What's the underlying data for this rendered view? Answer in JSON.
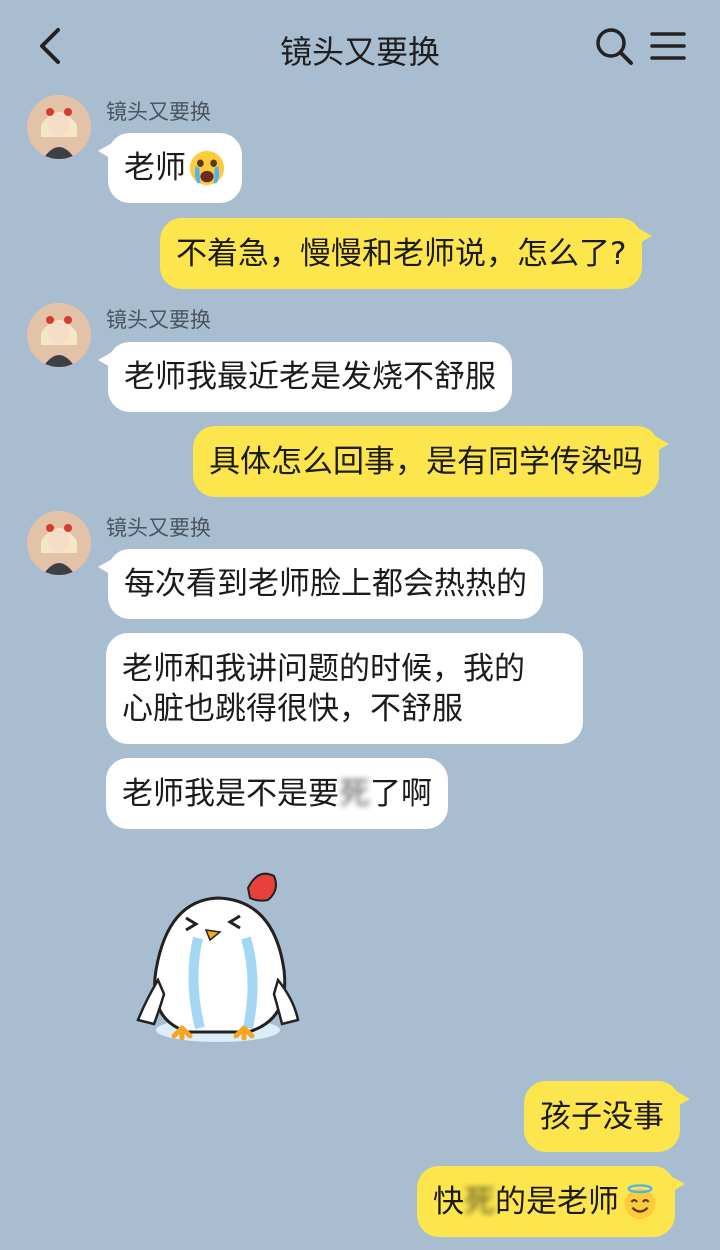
{
  "header": {
    "title": "镜头又要换",
    "back_icon": "chevron-left-icon",
    "search_icon": "search-icon",
    "menu_icon": "hamburger-menu-icon"
  },
  "messages": [
    {
      "sender": "镜头又要换",
      "text": "老师",
      "emoji": "crying-face-emoji"
    },
    {
      "text": "不着急，慢慢和老师说，怎么了?"
    },
    {
      "sender": "镜头又要换",
      "text": "老师我最近老是发烧不舒服"
    },
    {
      "text": "具体怎么回事，是有同学传染吗"
    },
    {
      "sender": "镜头又要换",
      "text": "每次看到老师脸上都会热热的"
    },
    {
      "line1": "老师和我讲问题的时候，我的",
      "line2": "心脏也跳得很快，不舒服"
    },
    {
      "before": "老师我是不是要",
      "censored": "死",
      "after": "了啊"
    },
    {
      "sticker": "crying-chick-sticker"
    },
    {
      "text": "孩子没事"
    },
    {
      "before": "快",
      "censored": "死",
      "after": "的是老师",
      "emoji": "smiling-face-with-halo-emoji"
    }
  ],
  "colors": {
    "background": "#a9bdd1",
    "outgoing_bubble": "#fde64d",
    "incoming_bubble": "#ffffff"
  }
}
